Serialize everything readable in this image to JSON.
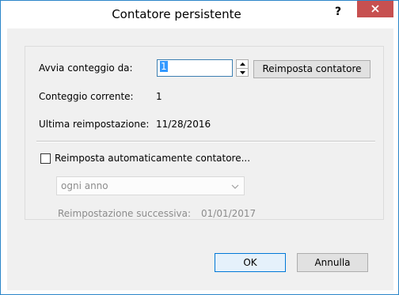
{
  "window": {
    "title": "Contatore persistente",
    "help_label": "?",
    "close_icon": "close-icon"
  },
  "counter": {
    "start_label": "Avvia conteggio da:",
    "start_value": "1",
    "reset_button_label": "Reimposta contatore",
    "current_label": "Conteggio corrente:",
    "current_value": "1",
    "last_reset_label": "Ultima reimpostazione:",
    "last_reset_value": "11/28/2016"
  },
  "auto_reset": {
    "checkbox_label": "Reimposta automaticamente contatore...",
    "checked": false,
    "frequency_selected": "ogni anno",
    "next_reset_label": "Reimpostazione successiva:",
    "next_reset_value": "01/01/2017"
  },
  "buttons": {
    "ok_label": "OK",
    "cancel_label": "Annulla"
  },
  "colors": {
    "close_button": "#c75050",
    "selection": "#3399ff",
    "disabled_text": "#8c8c8c",
    "dialog_background": "#f0f0f0"
  }
}
